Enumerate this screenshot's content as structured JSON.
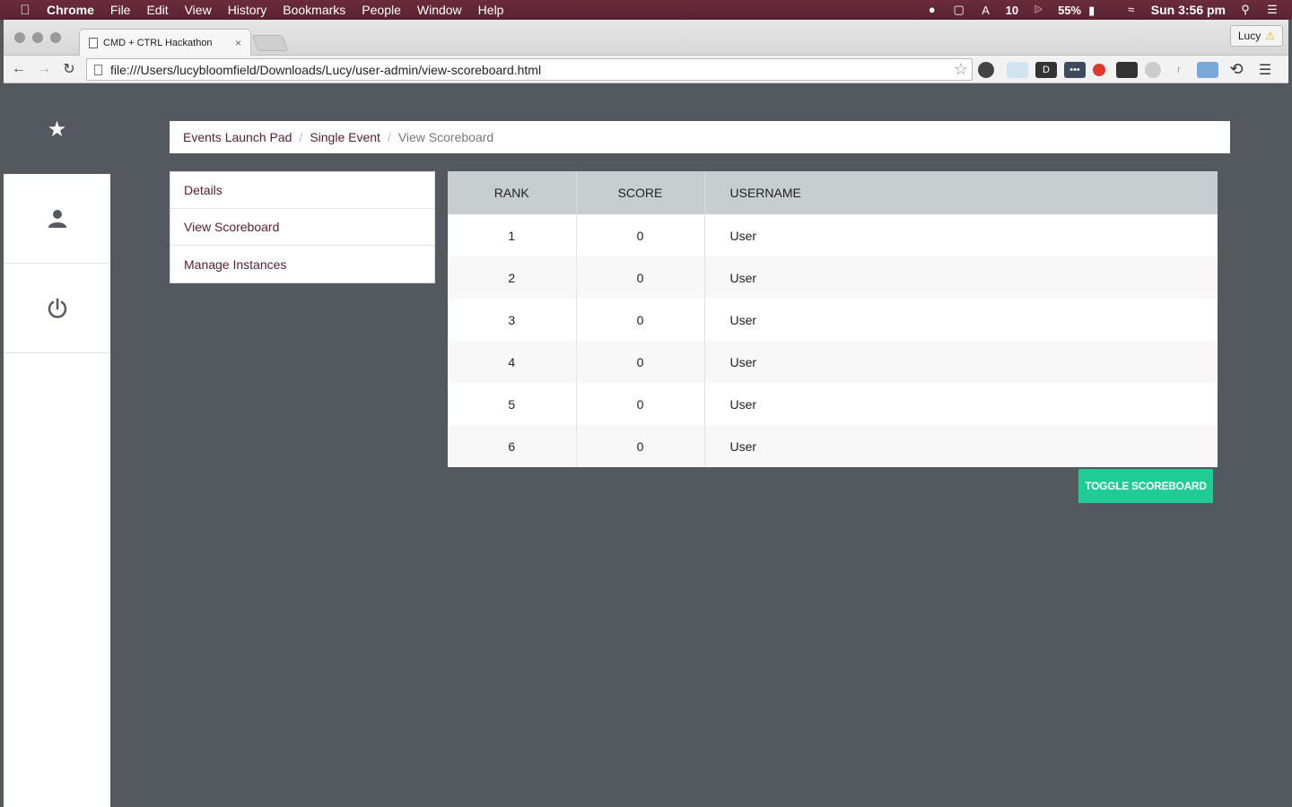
{
  "menubar": {
    "app": "Chrome",
    "items": [
      "File",
      "Edit",
      "View",
      "History",
      "Bookmarks",
      "People",
      "Window",
      "Help"
    ],
    "notifications": "10",
    "battery": "55%",
    "clock": "Sun 3:56 pm"
  },
  "browser": {
    "tab_title": "CMD + CTRL Hackathon",
    "tab_close": "×",
    "profile_name": "Lucy",
    "url": "file:///Users/lucybloomfield/Downloads/Lucy/user-admin/view-scoreboard.html"
  },
  "breadcrumb": {
    "items": [
      "Events Launch Pad",
      "Single Event"
    ],
    "current": "View Scoreboard",
    "separator": "/"
  },
  "subnav": {
    "items": [
      "Details",
      "View Scoreboard",
      "Manage Instances"
    ]
  },
  "table": {
    "headers": [
      "RANK",
      "SCORE",
      "USERNAME"
    ],
    "rows": [
      [
        "1",
        "0",
        "User"
      ],
      [
        "2",
        "0",
        "User"
      ],
      [
        "3",
        "0",
        "User"
      ],
      [
        "4",
        "0",
        "User"
      ],
      [
        "5",
        "0",
        "User"
      ],
      [
        "6",
        "0",
        "User"
      ]
    ]
  },
  "toggle_label": "TOGGLE SCOREBOARD",
  "colors": {
    "accent": "#1fcc93",
    "link": "#5c1d2e",
    "background": "#54585f",
    "table_header": "#c8cecf"
  },
  "icons": {
    "sidebar_top": "star-icon",
    "sidebar_user": "user-icon",
    "sidebar_power": "power-icon"
  }
}
